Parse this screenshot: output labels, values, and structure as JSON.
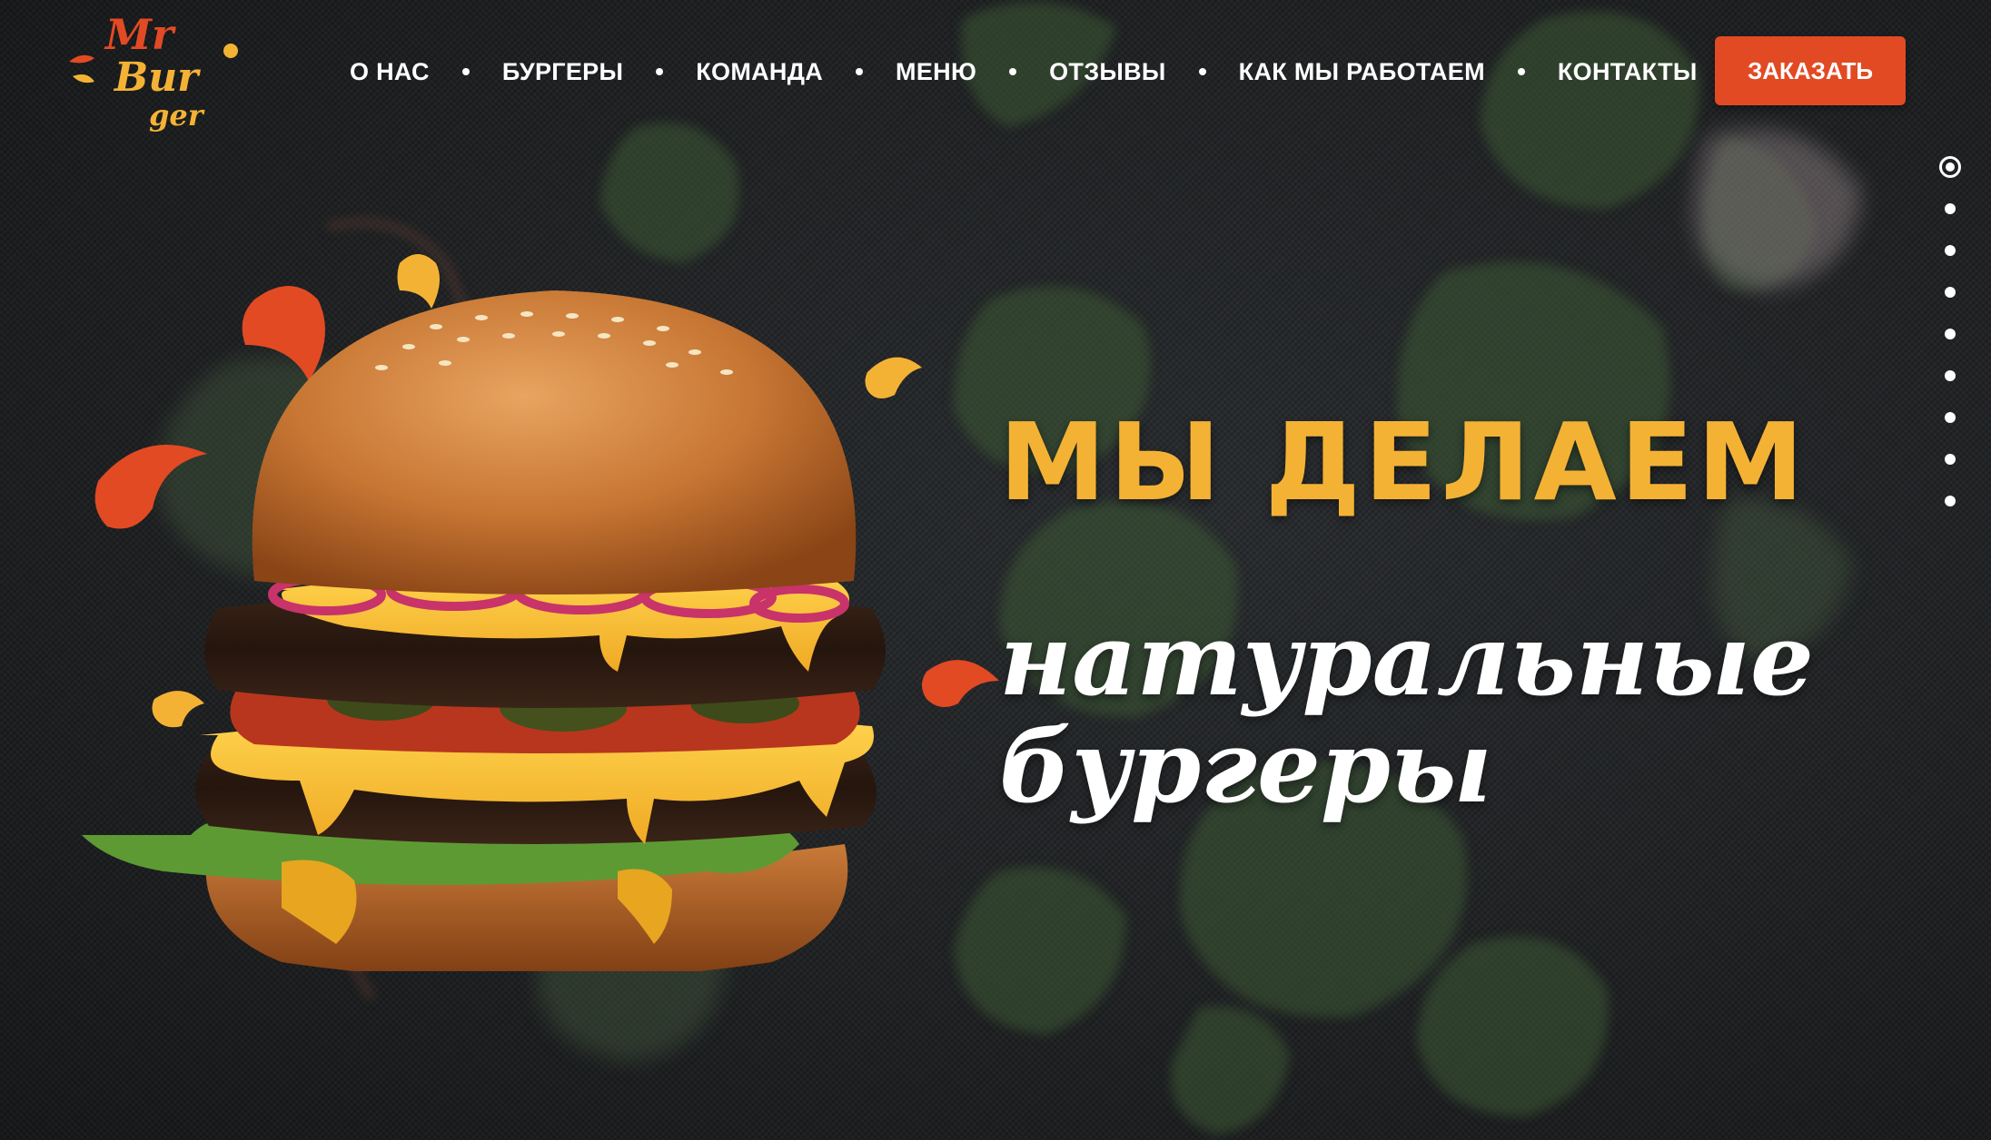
{
  "brand": {
    "logo_line1": "Mr",
    "logo_line2": "Bur",
    "logo_line3": "ger"
  },
  "nav": {
    "items": [
      {
        "label": "О НАС"
      },
      {
        "label": "БУРГЕРЫ"
      },
      {
        "label": "КОМАНДА"
      },
      {
        "label": "МЕНЮ"
      },
      {
        "label": "ОТЗЫВЫ"
      },
      {
        "label": "КАК МЫ РАБОТАЕМ"
      },
      {
        "label": "КОНТАКТЫ"
      }
    ],
    "order_label": "ЗАКАЗАТЬ"
  },
  "hero": {
    "headline_line1": "МЫ ДЕЛАЕМ",
    "headline_line2": "натуральные",
    "headline_line3": "бургеры"
  },
  "pager": {
    "total_slides": 9,
    "active_slide": 1
  },
  "colors": {
    "accent_orange": "#e24a24",
    "headline_yellow": "#f4b235",
    "background": "#1d1f21",
    "text_white": "#ffffff"
  },
  "icons": {
    "logo": "mr-burger-logo",
    "hero_image": "burger-illustration",
    "splash": "sauce-splash-icon"
  }
}
